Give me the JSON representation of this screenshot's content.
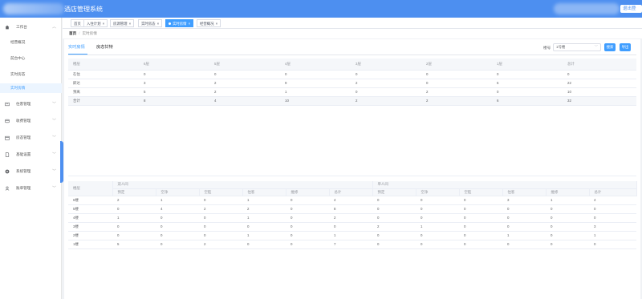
{
  "header": {
    "title": "酒店管理系统",
    "logout": "退出登录"
  },
  "sidebar": {
    "items": [
      {
        "label": "工作台",
        "icon": "home-icon",
        "expanded": true
      },
      {
        "label": "经营概况"
      },
      {
        "label": "前台中心"
      },
      {
        "label": "实时房态"
      },
      {
        "label": "实时房情"
      },
      {
        "label": "住客管理",
        "icon": "users-icon"
      },
      {
        "label": "收费管理",
        "icon": "wallet-icon"
      },
      {
        "label": "房态管理",
        "icon": "calendar-icon"
      },
      {
        "label": "基础设置",
        "icon": "document-icon"
      },
      {
        "label": "系统管理",
        "icon": "gear-icon"
      },
      {
        "label": "账单管理",
        "icon": "person-icon"
      }
    ],
    "active_sub": "实时房情"
  },
  "tags": [
    {
      "label": "首页"
    },
    {
      "label": "入住计划"
    },
    {
      "label": "房源管理"
    },
    {
      "label": "实时房态"
    },
    {
      "label": "实时房情",
      "active": true
    },
    {
      "label": "经营概况"
    }
  ],
  "breadcrumb": {
    "home": "首页",
    "current": "实时房情"
  },
  "tabs": [
    {
      "label": "实时房情",
      "active": true
    },
    {
      "label": "房态甘特"
    }
  ],
  "filter": {
    "label": "楼号",
    "value": "1号楼",
    "search_btn": "搜索",
    "export_btn": "导出"
  },
  "table1": {
    "headers": [
      "楼层",
      "6层",
      "5层",
      "4层",
      "3层",
      "2层",
      "1层",
      "总计"
    ],
    "rows": [
      [
        "在住",
        "0",
        "0",
        "0",
        "0",
        "0",
        "0",
        "0"
      ],
      [
        "即达",
        "3",
        "2",
        "9",
        "2",
        "0",
        "6",
        "22"
      ],
      [
        "预离",
        "5",
        "2",
        "1",
        "0",
        "2",
        "0",
        "10"
      ],
      [
        "合计",
        "8",
        "4",
        "10",
        "2",
        "2",
        "6",
        "32"
      ]
    ]
  },
  "table2": {
    "rowhead": "楼层",
    "groups": [
      "双人间",
      "单人间"
    ],
    "subheaders": [
      "预定",
      "空净",
      "空脏",
      "住客",
      "维修",
      "总计"
    ],
    "rows": [
      [
        "6楼",
        "2",
        "1",
        "0",
        "1",
        "0",
        "4",
        "0",
        "0",
        "0",
        "3",
        "1",
        "4"
      ],
      [
        "5楼",
        "0",
        "4",
        "2",
        "2",
        "0",
        "8",
        "0",
        "0",
        "0",
        "0",
        "0",
        "0"
      ],
      [
        "4楼",
        "1",
        "0",
        "0",
        "1",
        "0",
        "2",
        "0",
        "0",
        "0",
        "0",
        "0",
        "0"
      ],
      [
        "3楼",
        "0",
        "0",
        "0",
        "0",
        "0",
        "0",
        "2",
        "1",
        "0",
        "0",
        "0",
        "3"
      ],
      [
        "2楼",
        "0",
        "0",
        "0",
        "1",
        "0",
        "1",
        "0",
        "0",
        "0",
        "1",
        "0",
        "1"
      ],
      [
        "1楼",
        "5",
        "0",
        "2",
        "0",
        "0",
        "7",
        "0",
        "0",
        "0",
        "0",
        "0",
        "0"
      ]
    ]
  },
  "colors": {
    "primary": "#409eff",
    "header_bg": "#4d8ff0"
  }
}
